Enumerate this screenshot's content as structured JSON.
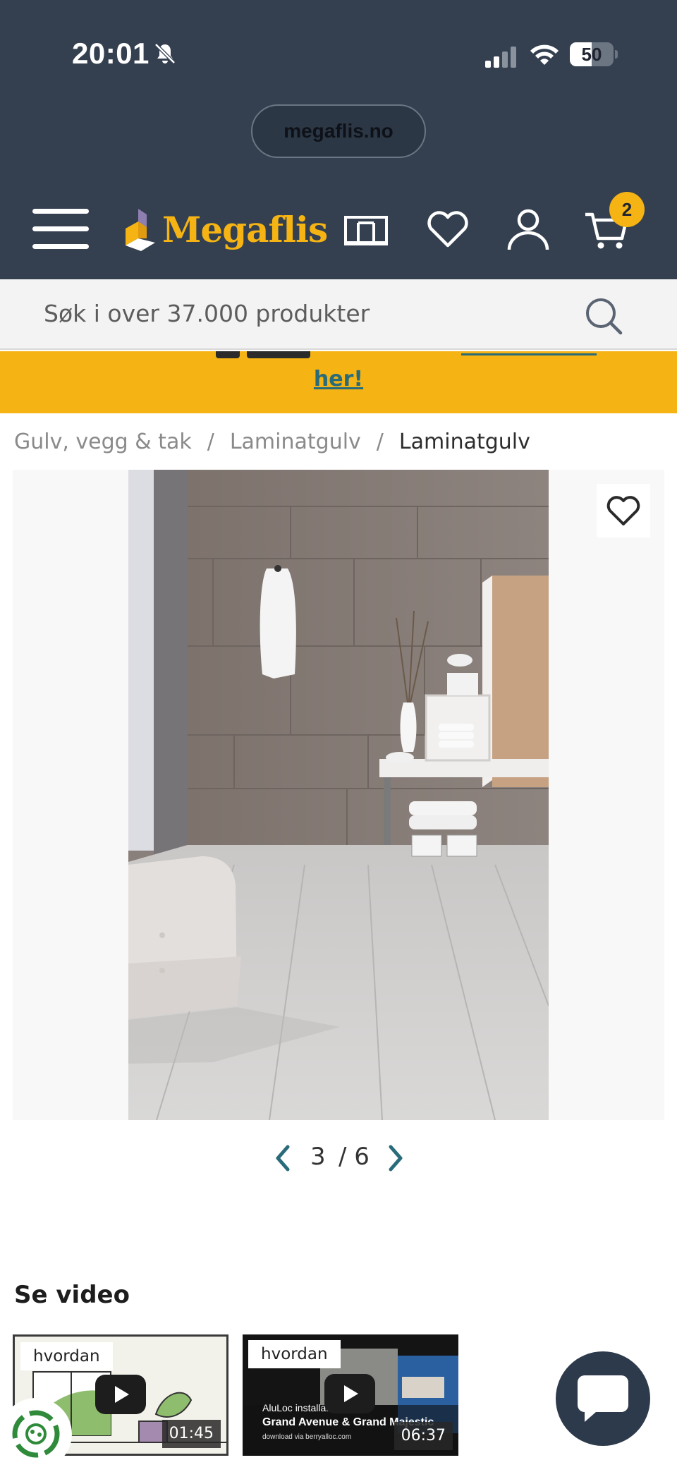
{
  "status_bar": {
    "time": "20:01",
    "battery": "50",
    "battery_level": 0.5,
    "icons": [
      "bell-slash-icon",
      "signal-icon",
      "wifi-icon",
      "battery-icon"
    ]
  },
  "browser": {
    "url": "megaflis.no"
  },
  "header": {
    "logo_text": "Megaflis",
    "cart_count": "2",
    "icons": [
      "menu-icon",
      "showroom-icon",
      "heart-icon",
      "user-icon",
      "cart-icon"
    ]
  },
  "search": {
    "placeholder": "Søk i over 37.000 produkter"
  },
  "banner": {
    "link_text": "her!"
  },
  "breadcrumb": {
    "items": [
      "Gulv, vegg & tak",
      "Laminatgulv",
      "Laminatgulv"
    ]
  },
  "gallery": {
    "current": "3",
    "separator": "/",
    "total": "6"
  },
  "video_section": {
    "title": "Se video",
    "videos": [
      {
        "tag": "hvordan",
        "duration": "01:45"
      },
      {
        "tag": "hvordan",
        "duration": "06:37",
        "caption_line1": "AluLoc installation",
        "caption_line2": "Grand Avenue & Grand Majestic",
        "caption_line3": "download via berryalloc.com"
      }
    ]
  },
  "colors": {
    "header_bg": "#344050",
    "brand_yellow": "#f5b414",
    "link_teal": "#2a6b7a"
  }
}
